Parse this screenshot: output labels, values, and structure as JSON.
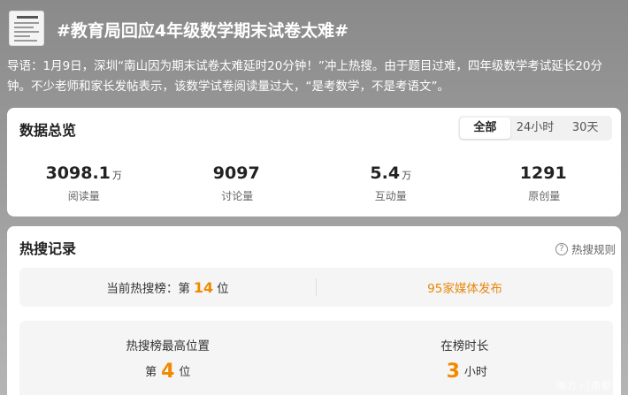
{
  "header": {
    "title": "#教育局回应4年级数学期末试卷太难#"
  },
  "intro": "导语：1月9日，深圳“南山因为期末试卷太难延时20分钟！”冲上热搜。由于题目过难，四年级数学考试延长20分钟。不少老师和家长发帖表示，该数学试卷阅读量过大，“是考数学，不是考语文”。",
  "overview": {
    "title": "数据总览",
    "tabs": [
      "全部",
      "24小时",
      "30天"
    ],
    "active_tab": "全部",
    "stats": [
      {
        "value": "3098.1",
        "unit": "万",
        "label": "阅读量"
      },
      {
        "value": "9097",
        "unit": "",
        "label": "讨论量"
      },
      {
        "value": "5.4",
        "unit": "万",
        "label": "互动量"
      },
      {
        "value": "1291",
        "unit": "",
        "label": "原创量"
      }
    ]
  },
  "hot": {
    "title": "热搜记录",
    "rule_label": "热搜规则",
    "current_rank_prefix": "当前热搜榜：第",
    "current_rank": "14",
    "current_rank_suffix": "位",
    "media_link": "95家媒体发布",
    "best_label": "热搜榜最高位置",
    "best_prefix": "第",
    "best_rank": "4",
    "best_suffix": "位",
    "duration_label": "在榜时长",
    "duration_value": "3",
    "duration_unit": "小时"
  },
  "watermark": "南方+|南都周",
  "colors": {
    "accent": "#f08a00",
    "link": "#e8870b",
    "header_bg": "#8a8a8a"
  }
}
